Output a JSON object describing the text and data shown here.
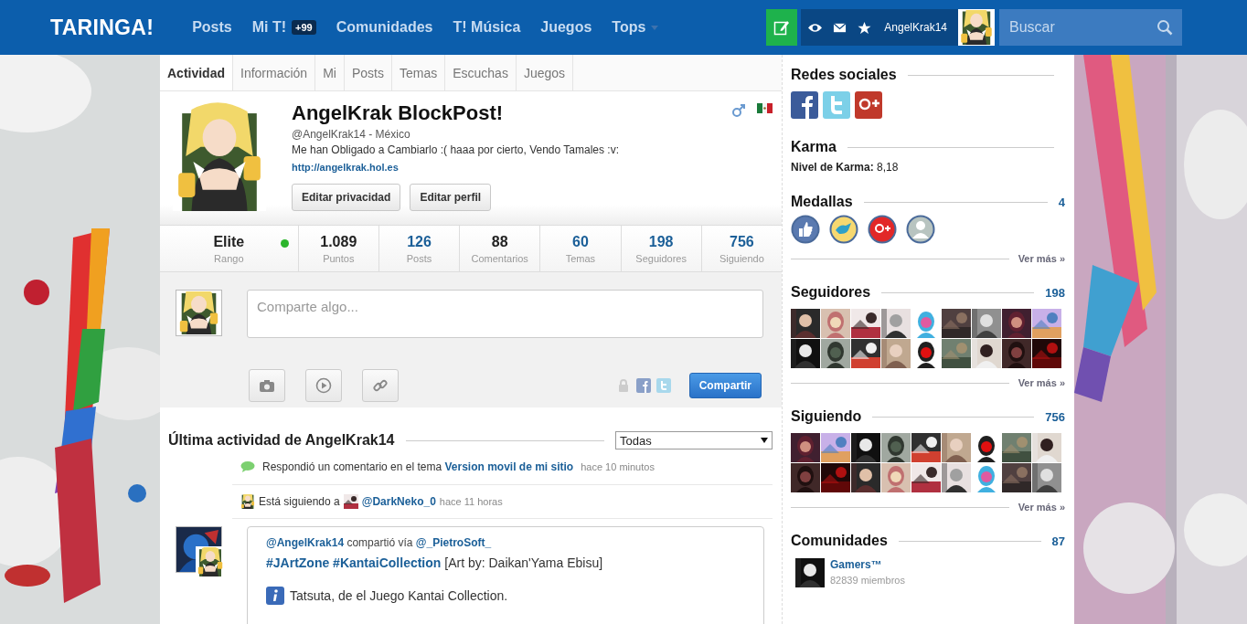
{
  "header": {
    "logo": "TARINGA!",
    "nav": [
      {
        "label": "Posts"
      },
      {
        "label": "Mi T!",
        "badge": "+99"
      },
      {
        "label": "Comunidades"
      },
      {
        "label": "T! Música"
      },
      {
        "label": "Juegos"
      },
      {
        "label": "Tops",
        "menu": true
      }
    ],
    "username": "AngelKrak14",
    "search": {
      "placeholder": "Buscar"
    }
  },
  "tabs": [
    {
      "label": "Actividad",
      "selected": true
    },
    {
      "label": "Información",
      "selected": false
    },
    {
      "label": "Mi",
      "selected": false
    },
    {
      "label": "Posts",
      "selected": false
    },
    {
      "label": "Temas",
      "selected": false
    },
    {
      "label": "Escuchas",
      "selected": false
    },
    {
      "label": "Juegos",
      "selected": false
    }
  ],
  "profile": {
    "name": "AngelKrak BlockPost!",
    "handle": "@AngelKrak14 - México",
    "bio": "Me han Obligado a Cambiarlo :( haaa por cierto, Vendo Tamales :v:",
    "website": "http://angelkrak.hol.es",
    "buttons": [
      "Editar privacidad",
      "Editar perfil"
    ]
  },
  "rank": {
    "value": "Elite",
    "label": "Rango",
    "online": true
  },
  "stats": [
    {
      "value": "1.089",
      "label": "Puntos",
      "link": false
    },
    {
      "value": "126",
      "label": "Posts",
      "link": true
    },
    {
      "value": "88",
      "label": "Comentarios",
      "link": false
    },
    {
      "value": "60",
      "label": "Temas",
      "link": true
    },
    {
      "value": "198",
      "label": "Seguidores",
      "link": true
    },
    {
      "value": "756",
      "label": "Siguiendo",
      "link": true
    }
  ],
  "composer": {
    "placeholder": "Comparte algo...",
    "submit": "Compartir"
  },
  "activity": {
    "title": "Última actividad de AngelKrak14",
    "filter": "Todas",
    "items": [
      {
        "kind": "comment",
        "text": "Respondió un comentario en el tema",
        "link": "Version movil de mi sitio",
        "time": "hace 10 minutos"
      },
      {
        "kind": "follow",
        "text": "Está siguiendo a",
        "link": "@DarkNeko_0",
        "time": "hace 11 horas"
      },
      {
        "kind": "share",
        "author": "@AngelKrak14",
        "text": "compartió vía",
        "link": "@_PietroSoft_",
        "tags": "#JArtZone #KantaiCollection",
        "body": "[Art by: Daikan'Yama Ebisu]",
        "note": "Tatsuta, de el Juego Kantai Collection."
      }
    ]
  },
  "sidebar": {
    "social": {
      "title": "Redes sociales"
    },
    "karma": {
      "title": "Karma",
      "text": "**Nivel de Karma:** 8,18"
    },
    "medals": {
      "title": "Medallas",
      "count": "4",
      "more": "Ver más »"
    },
    "followers": {
      "title": "Seguidores",
      "count": "198",
      "more": "Ver más »"
    },
    "following": {
      "title": "Siguiendo",
      "count": "756",
      "more": "Ver más »"
    },
    "communities": {
      "title": "Comunidades",
      "count": "87",
      "items": [
        {
          "name": "Gamers™",
          "members": "82839 miembros"
        }
      ]
    }
  }
}
